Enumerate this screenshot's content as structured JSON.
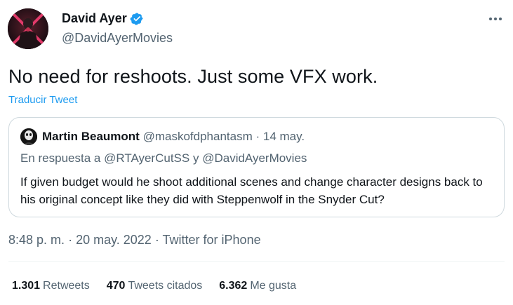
{
  "author": {
    "name": "David Ayer",
    "handle": "@DavidAyerMovies",
    "verified_color": "#1d9bf0"
  },
  "tweet": {
    "text": "No need for reshoots. Just some VFX work.",
    "translate_label": "Traducir Tweet"
  },
  "quoted": {
    "name": "Martin Beaumont",
    "handle": "@maskofdphantasm",
    "separator": "·",
    "date": "14 may.",
    "reply_prefix": "En respuesta a",
    "reply_mention_1": "@RTAyerCutSS",
    "reply_join": "y",
    "reply_mention_2": "@DavidAyerMovies",
    "text": "If given budget would he shoot additional scenes and change character designs back to his original concept like they did with Steppenwolf in the Snyder Cut?"
  },
  "meta": {
    "time": "8:48 p. m.",
    "separator_1": "·",
    "date": "20 may. 2022",
    "separator_2": "·",
    "source": "Twitter for iPhone"
  },
  "stats": {
    "retweets_count": "1.301",
    "retweets_label": "Retweets",
    "quotes_count": "470",
    "quotes_label": "Tweets citados",
    "likes_count": "6.362",
    "likes_label": "Me gusta"
  },
  "icons": {
    "verified": "verified-badge-icon",
    "more": "more-options-icon"
  },
  "colors": {
    "link": "#1d9bf0",
    "secondary_text": "#536471",
    "primary_text": "#0f1419",
    "border": "#cfd9de"
  }
}
